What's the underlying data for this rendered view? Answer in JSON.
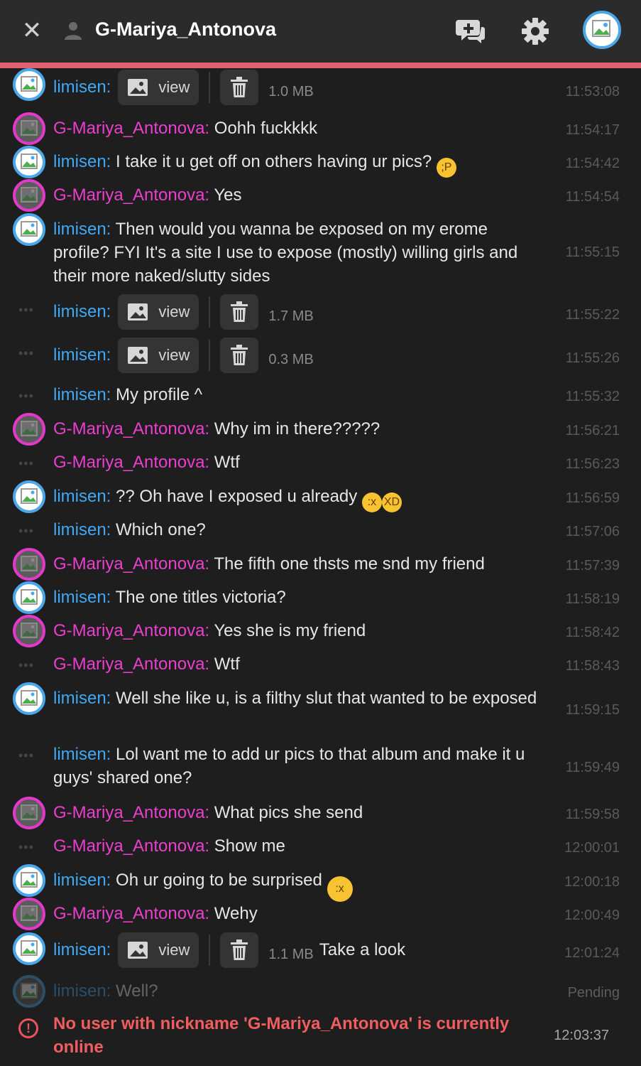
{
  "header": {
    "close_icon": "close-icon",
    "user_icon": "user-icon",
    "title": "G-Mariya_Antonova",
    "new_chat_icon": "add-chat-icon",
    "settings_icon": "gear-icon",
    "avatar_icon": "avatar-image",
    "accent_color": "#e0606f"
  },
  "colors": {
    "me": "#3fa9f5",
    "them": "#ec3fcf",
    "error": "#f25e5f"
  },
  "messages": [
    {
      "nick": "limisen:",
      "view_label": "view",
      "size": "1.0 MB",
      "caption": "",
      "time": "11:53:08"
    },
    {
      "nick": "G-Mariya_Antonova:",
      "text": "Oohh fuckkkk",
      "time": "11:54:17"
    },
    {
      "nick": "limisen:",
      "text": "I take it u get off on others having ur pics?",
      "emoji": "😜",
      "time": "11:54:42"
    },
    {
      "nick": "G-Mariya_Antonova:",
      "text": "Yes",
      "time": "11:54:54"
    },
    {
      "nick": "limisen:",
      "text": "Then would you wanna be exposed on my erome profile? FYI It's a site I use to expose (mostly) willing girls and their more naked/slutty sides",
      "time": "11:55:15"
    },
    {
      "nick": "limisen:",
      "view_label": "view",
      "size": "1.7 MB",
      "caption": "",
      "time": "11:55:22"
    },
    {
      "nick": "limisen:",
      "view_label": "view",
      "size": "0.3 MB",
      "caption": "",
      "time": "11:55:26"
    },
    {
      "nick": "limisen:",
      "text": "My profile ^",
      "time": "11:55:32"
    },
    {
      "nick": "G-Mariya_Antonova:",
      "text": "Why im in there?????",
      "time": "11:56:21"
    },
    {
      "nick": "G-Mariya_Antonova:",
      "text": "Wtf",
      "time": "11:56:23"
    },
    {
      "nick": "limisen:",
      "text": "?? Oh have I exposed u already",
      "emoji": "🤭🤣",
      "time": "11:56:59"
    },
    {
      "nick": "limisen:",
      "text": "Which one?",
      "time": "11:57:06"
    },
    {
      "nick": "G-Mariya_Antonova:",
      "text": "The fifth one thsts me snd my friend",
      "time": "11:57:39"
    },
    {
      "nick": "limisen:",
      "text": "The one titles victoria?",
      "time": "11:58:19"
    },
    {
      "nick": "G-Mariya_Antonova:",
      "text": "Yes she is my friend",
      "time": "11:58:42"
    },
    {
      "nick": "G-Mariya_Antonova:",
      "text": "Wtf",
      "time": "11:58:43"
    },
    {
      "nick": "limisen:",
      "text": "Well she like u, is a filthy slut that wanted to be exposed",
      "time": "11:59:15"
    },
    {
      "nick": "limisen:",
      "text": "Lol want me to add ur pics to that album and make it u guys' shared one?",
      "time": "11:59:49"
    },
    {
      "nick": "G-Mariya_Antonova:",
      "text": "What pics she send",
      "time": "11:59:58"
    },
    {
      "nick": "G-Mariya_Antonova:",
      "text": "Show me",
      "time": "12:00:01"
    },
    {
      "nick": "limisen:",
      "text": "Oh ur going to be surprised",
      "emoji": "🤭",
      "time": "12:00:18"
    },
    {
      "nick": "G-Mariya_Antonova:",
      "text": "Wehy",
      "time": "12:00:49"
    },
    {
      "nick": "limisen:",
      "view_label": "view",
      "size": "1.1 MB",
      "caption": "Take a look",
      "time": "12:01:24"
    },
    {
      "nick": "limisen:",
      "text": "Well?",
      "time": "Pending"
    }
  ],
  "error": {
    "icon": "alert-circle-icon",
    "text": "No user with nickname 'G-Mariya_Antonova' is currently online",
    "time": "12:03:37"
  }
}
